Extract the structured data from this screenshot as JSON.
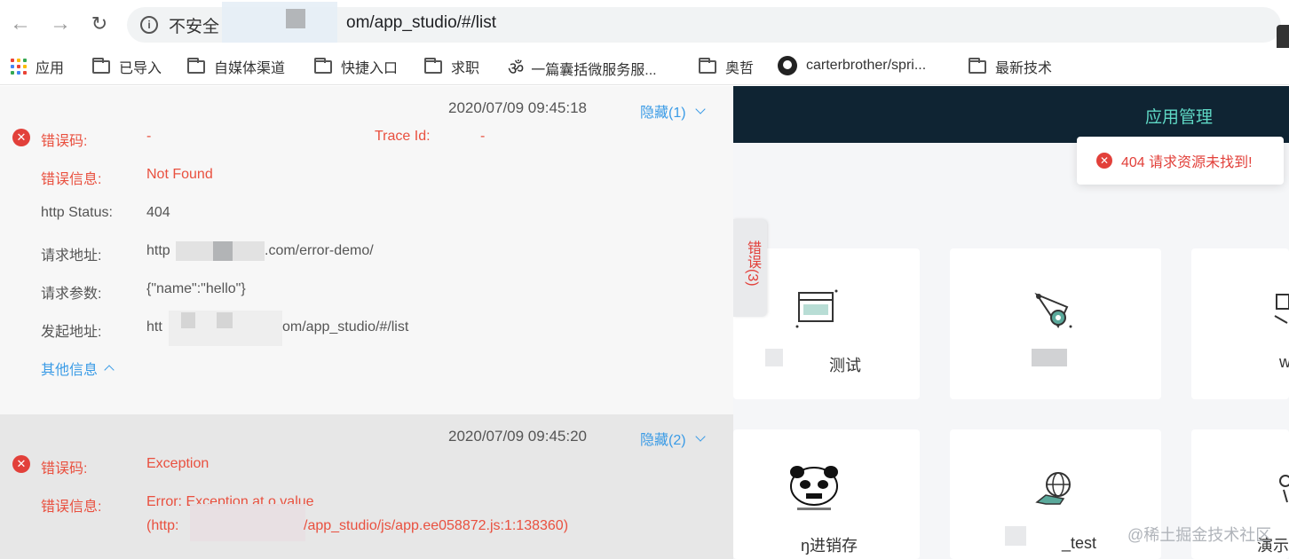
{
  "browser": {
    "security_label": "不安全",
    "url_visible": "om/app_studio/#/list",
    "info_icon": "i"
  },
  "bookmarks": [
    {
      "label": "应用",
      "icon": "apps-grid-icon"
    },
    {
      "label": "已导入",
      "icon": "folder-icon"
    },
    {
      "label": "自媒体渠道",
      "icon": "folder-icon"
    },
    {
      "label": "快捷入口",
      "icon": "folder-icon"
    },
    {
      "label": "求职",
      "icon": "folder-icon"
    },
    {
      "label": "一篇囊括微服务服...",
      "icon": "om-glyph-icon"
    },
    {
      "label": "奥哲",
      "icon": "folder-icon"
    },
    {
      "label": "carterbrother/spri...",
      "icon": "github-icon"
    },
    {
      "label": "最新技术",
      "icon": "folder-icon"
    }
  ],
  "app": {
    "header_title": "应用管理",
    "toast_text": "404 请求资源未找到!",
    "error_tab": "错误(3)",
    "cards": [
      {
        "label": "测试"
      },
      {
        "label": ""
      },
      {
        "label": "w"
      },
      {
        "label": "ŋ进销存"
      },
      {
        "label": "_test"
      },
      {
        "label": "演示"
      }
    ],
    "watermark": "@稀土掘金技术社区"
  },
  "errors": [
    {
      "timestamp": "2020/07/09 09:45:18",
      "toggle": "隐藏(1)",
      "code_label": "错误码:",
      "code_value": "-",
      "trace_label": "Trace Id:",
      "trace_value": "-",
      "msg_label": "错误信息:",
      "msg_value": "Not Found",
      "status_label": "http Status:",
      "status_value": "404",
      "req_url_label": "请求地址:",
      "req_url_prefix": "http",
      "req_url_suffix": ".com/error-demo/",
      "req_params_label": "请求参数:",
      "req_params_value": "{\"name\":\"hello\"}",
      "origin_label": "发起地址:",
      "origin_prefix": "htt",
      "origin_suffix": "om/app_studio/#/list",
      "more_label": "其他信息"
    },
    {
      "timestamp": "2020/07/09 09:45:20",
      "toggle": "隐藏(2)",
      "code_label": "错误码:",
      "code_value": "Exception",
      "msg_label": "错误信息:",
      "msg_line1": "Error: Exception at o.value",
      "msg_line2_prefix": "(http:",
      "msg_line2_suffix": "/app_studio/js/app.ee058872.js:1:138360)"
    }
  ],
  "colors": {
    "error_red": "#e2403a",
    "link_blue": "#3a9be6",
    "header_dark": "#0f2433",
    "header_accent": "#5fd8c5"
  }
}
